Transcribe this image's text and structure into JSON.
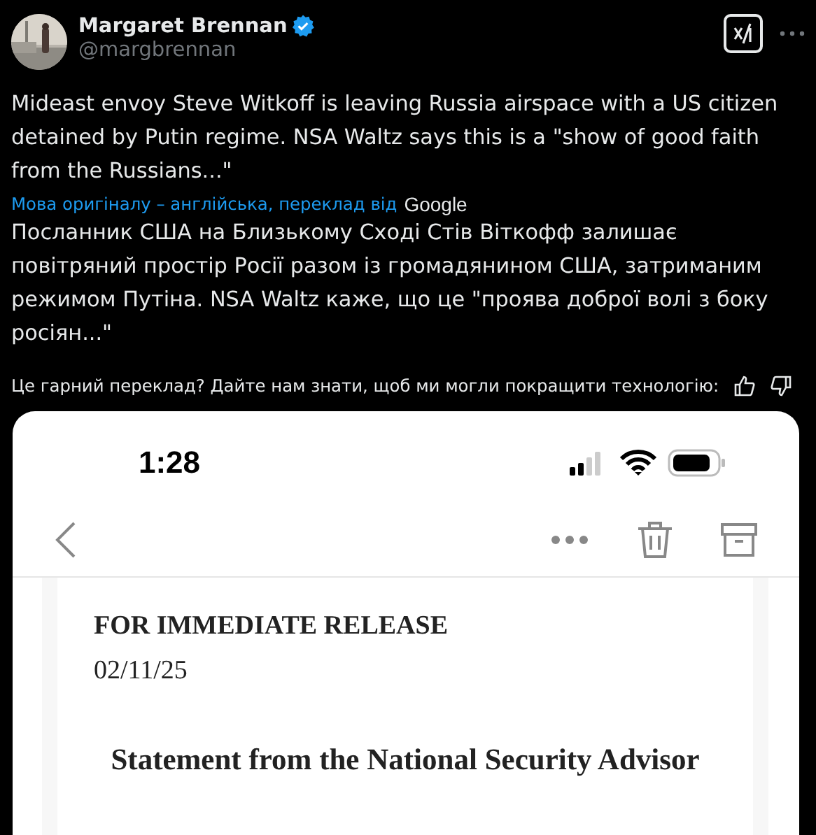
{
  "author": {
    "name": "Margaret Brennan",
    "handle": "@margbrennan",
    "verified": true
  },
  "tweet_text": "Mideast envoy Steve Witkoff is leaving Russia airspace with a US citizen detained by Putin regime. NSA Waltz says this is a \"show of good faith from the Russians...\"",
  "translation": {
    "source_label": "Мова оригіналу – англійська, переклад від",
    "provider": "Google",
    "text": "Посланник США на Близькому Сході Стів Віткофф залишає повітряний простір Росії разом із громадянином США, затриманим режимом Путіна. NSA Waltz каже, що це \"проява доброї волі з боку росіян...\""
  },
  "feedback": {
    "prompt": "Це гарний переклад? Дайте нам знати, щоб ми могли покращити технологію:"
  },
  "screenshot": {
    "status_bar": {
      "time": "1:28"
    },
    "document": {
      "heading": "FOR IMMEDIATE RELEASE",
      "date": "02/11/25",
      "title": "Statement from the National Security Advisor"
    }
  }
}
